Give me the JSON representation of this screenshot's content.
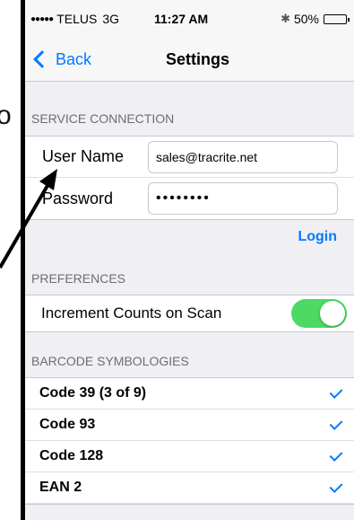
{
  "stray_text": "o",
  "status_bar": {
    "signal": "●●●●●",
    "carrier": "TELUS",
    "network": "3G",
    "time": "11:27 AM",
    "battery_text": "50%",
    "battery_level": 0.5
  },
  "nav": {
    "back_label": "Back",
    "title": "Settings"
  },
  "service_connection": {
    "header": "SERVICE CONNECTION",
    "username_label": "User Name",
    "username_value": "sales@tracrite.net",
    "password_label": "Password",
    "password_value": "••••••••",
    "login_label": "Login"
  },
  "preferences": {
    "header": "PREFERENCES",
    "increment_label": "Increment Counts on Scan",
    "increment_on": true
  },
  "barcode": {
    "header": "BARCODE SYMBOLOGIES",
    "items": [
      {
        "label": "Code 39 (3 of 9)",
        "checked": true
      },
      {
        "label": "Code 93",
        "checked": true
      },
      {
        "label": "Code 128",
        "checked": true
      },
      {
        "label": "EAN 2",
        "checked": true
      }
    ]
  },
  "colors": {
    "accent": "#007aff",
    "toggle_on": "#4cd964",
    "background": "#efeff4"
  }
}
